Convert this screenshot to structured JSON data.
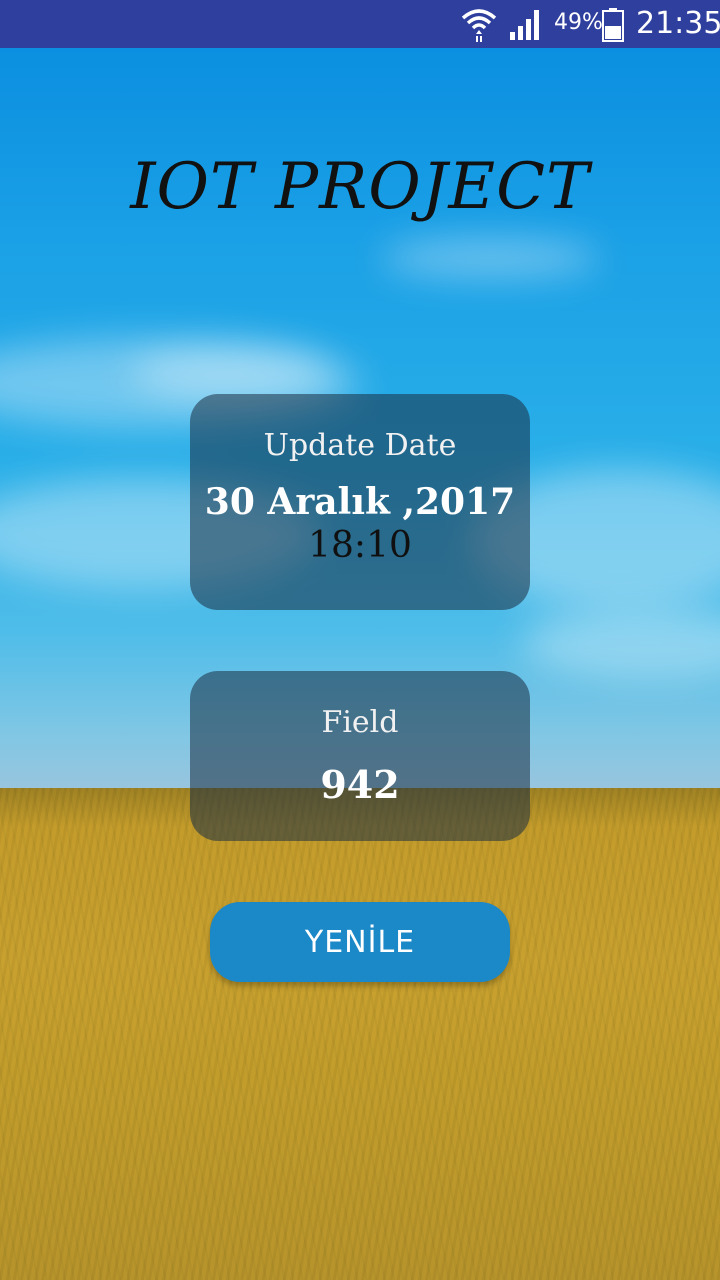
{
  "status_bar": {
    "battery_percent": "49%",
    "time": "21:35",
    "icons": [
      "wifi-icon",
      "signal-icon",
      "battery-icon"
    ]
  },
  "app": {
    "title": "IOT PROJECT"
  },
  "update_card": {
    "label": "Update Date",
    "date": "30 Aralık ,2017",
    "time": "18:10"
  },
  "field_card": {
    "label": "Field",
    "value": "942"
  },
  "refresh_button": {
    "label": "YENİLE"
  },
  "colors": {
    "status_bar": "#2f3f9e",
    "button": "#1b88c8",
    "card_bg": "rgba(25,45,65,0.55)"
  }
}
